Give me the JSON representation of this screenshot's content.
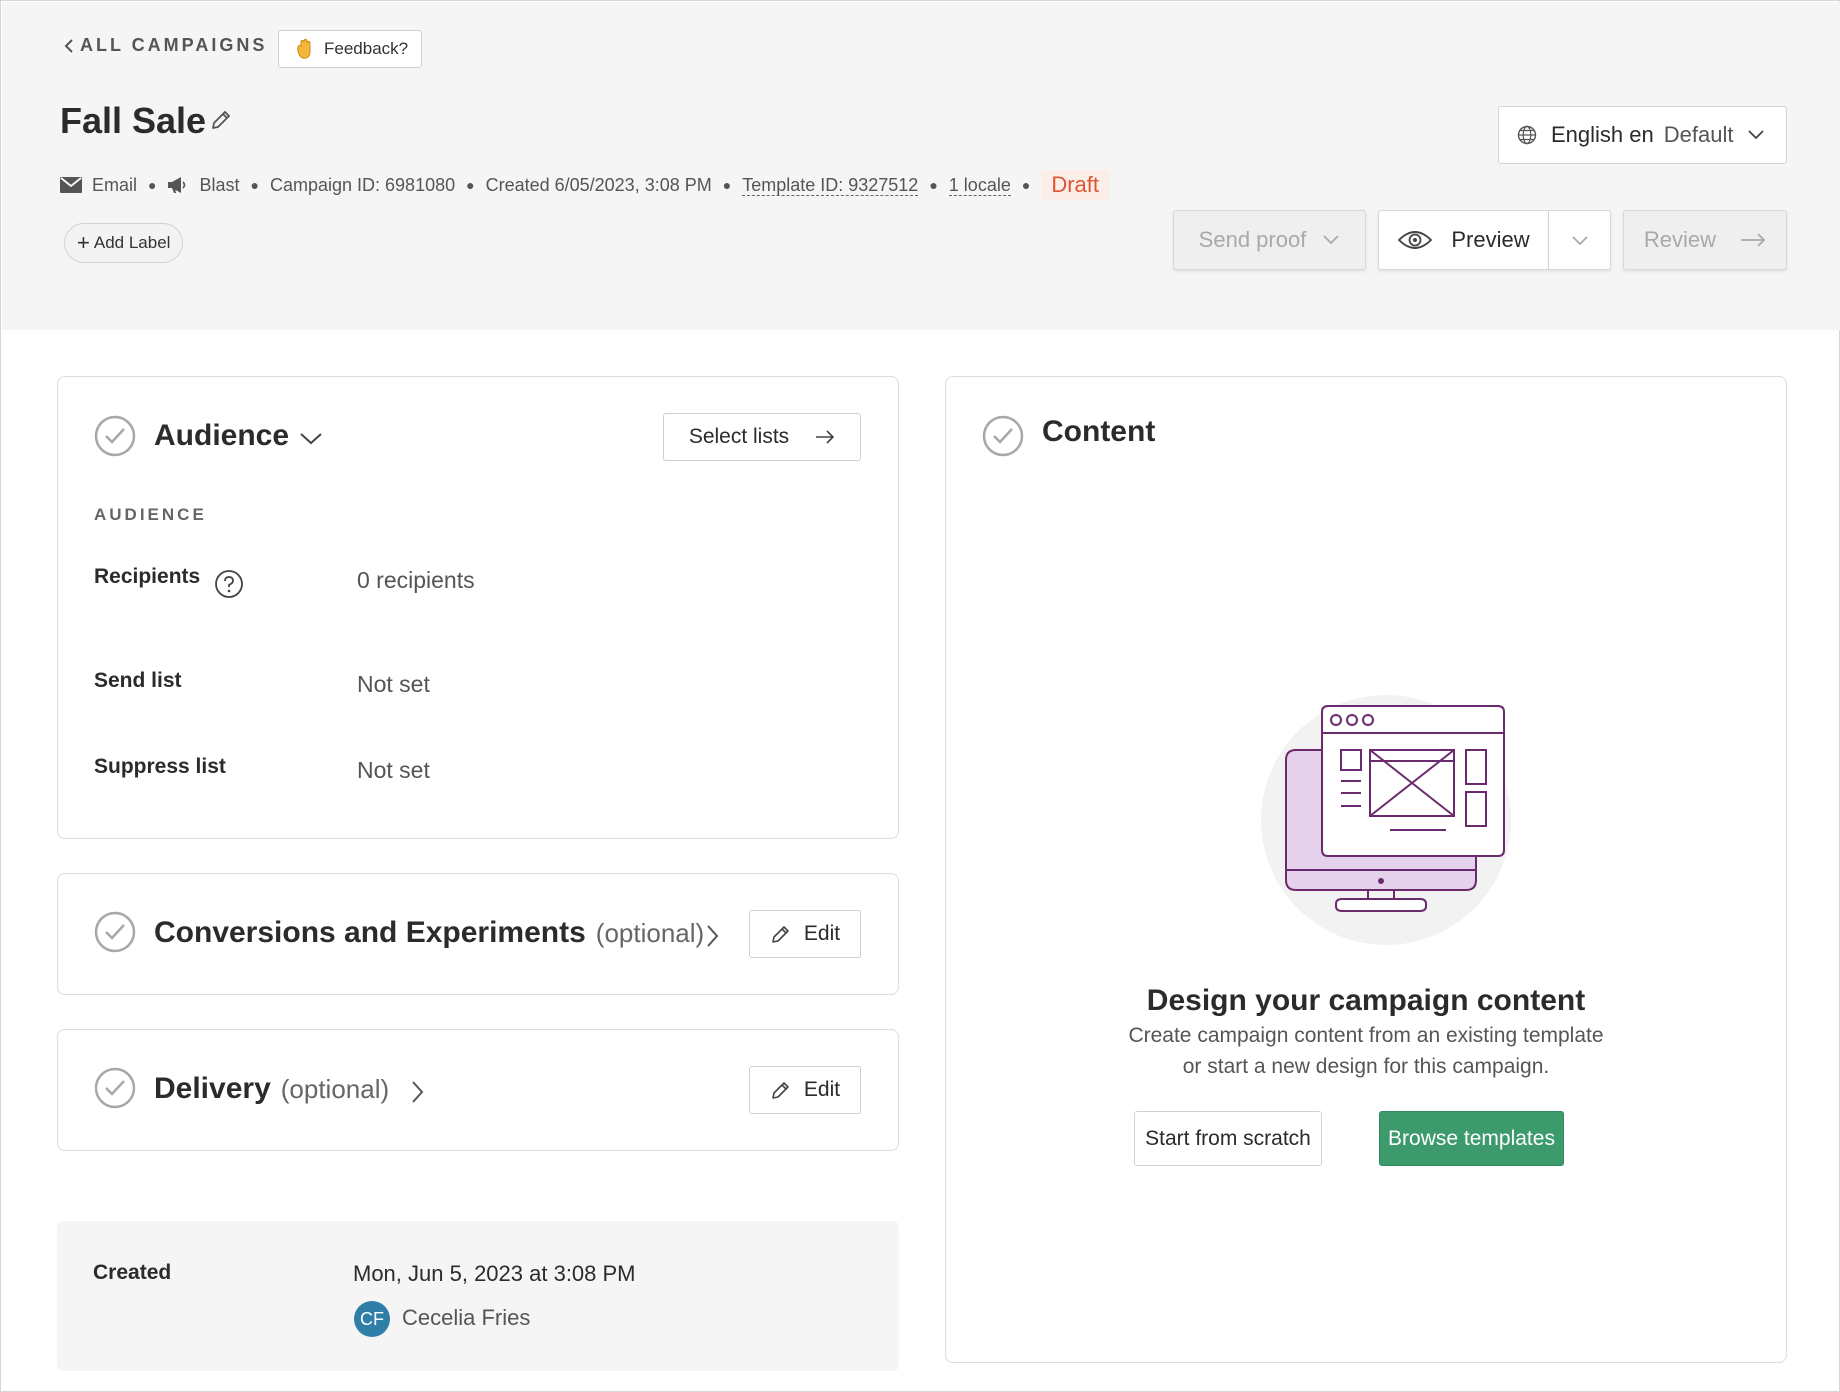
{
  "header": {
    "back_label": "ALL CAMPAIGNS",
    "feedback_label": "Feedback?",
    "feedback_icon": "waving-hand-icon",
    "title": "Fall Sale",
    "meta": {
      "channel": "Email",
      "type": "Blast",
      "campaign_id": "Campaign ID: 6981080",
      "created": "Created 6/05/2023, 3:08 PM",
      "template_id": "Template ID: 9327512",
      "locales": "1 locale",
      "status": "Draft"
    },
    "add_label": "Add Label",
    "locale": {
      "language": "English en",
      "default_label": "Default"
    },
    "actions": {
      "send_proof": "Send proof",
      "preview": "Preview",
      "review": "Review"
    }
  },
  "audience": {
    "title": "Audience",
    "select_lists": "Select lists",
    "section_label": "AUDIENCE",
    "rows": [
      {
        "label": "Recipients",
        "value": "0 recipients"
      },
      {
        "label": "Send list",
        "value": "Not set"
      },
      {
        "label": "Suppress list",
        "value": "Not set"
      }
    ]
  },
  "conversions": {
    "title": "Conversions and Experiments",
    "optional": "(optional)",
    "edit": "Edit"
  },
  "delivery": {
    "title": "Delivery",
    "optional": "(optional)",
    "edit": "Edit"
  },
  "created": {
    "label": "Created",
    "date": "Mon, Jun 5, 2023 at 3:08 PM",
    "initials": "CF",
    "name": "Cecelia Fries"
  },
  "content": {
    "title": "Content",
    "heading": "Design your campaign content",
    "description_line1": "Create campaign content from an existing template",
    "description_line2": "or start a new design for this campaign.",
    "start_scratch": "Start from scratch",
    "browse_templates": "Browse templates"
  },
  "colors": {
    "accent_green": "#3d9a6d",
    "draft": "#e0552f",
    "illustration_purple": "#6b2a6d",
    "avatar": "#2f7ea8"
  }
}
